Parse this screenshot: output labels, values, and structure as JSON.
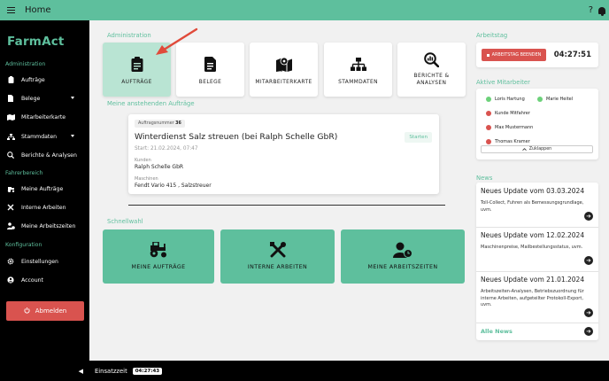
{
  "topbar": {
    "title": "Home",
    "help": "?"
  },
  "sidebar": {
    "brand": "FarmAct",
    "sections": [
      "Administration",
      "Fahrerbereich",
      "Konfiguration"
    ],
    "admin_items": [
      {
        "label": "Aufträge",
        "icon": "clipboard-icon"
      },
      {
        "label": "Belege",
        "icon": "document-icon"
      },
      {
        "label": "Mitarbeiterkarte",
        "icon": "map-icon"
      },
      {
        "label": "Stammdaten",
        "icon": "hierarchy-icon"
      },
      {
        "label": "Berichte & Analysen",
        "icon": "search-chart-icon"
      }
    ],
    "driver_items": [
      {
        "label": "Meine Aufträge",
        "icon": "tractor-icon"
      },
      {
        "label": "Interne Arbeiten",
        "icon": "tools-icon"
      },
      {
        "label": "Meine Arbeitszeiten",
        "icon": "user-clock-icon"
      }
    ],
    "config_items": [
      {
        "label": "Einstellungen",
        "icon": "gear-icon"
      },
      {
        "label": "Account",
        "icon": "account-icon"
      }
    ],
    "logout_label": "Abmelden"
  },
  "main": {
    "admin_heading": "Administration",
    "tiles": [
      "AUFTRÄGE",
      "BELEGE",
      "MITARBEITERKARTE",
      "STAMMDATEN",
      "BERICHTE &",
      "ANALYSEN"
    ],
    "pending_heading": "Meine anstehenden Aufträge",
    "task": {
      "order_label": "Auftragsnummer",
      "order_number": "36",
      "title": "Winterdienst Salz streuen (bei Ralph Schelle GbR)",
      "start_button": "Starten",
      "start": "Start: 21.02.2024, 07:47",
      "customer_label": "Kunden",
      "customer": "Ralph Schelle GbR",
      "machines_label": "Maschinen",
      "machines": "Fendt Vario 415 , Salzstreuer"
    },
    "quick_heading": "Schnellwahl",
    "quick": [
      "MEINE AUFTRÄGE",
      "INTERNE ARBEITEN",
      "MEINE ARBEITSZEITEN"
    ]
  },
  "right": {
    "workday_heading": "Arbeitstag",
    "end_day_label": "ARBEITSTAG BEENDEN",
    "workday_time": "04:27:51",
    "active_heading": "Aktive Mitarbeiter",
    "employees": [
      {
        "name": "Loris Hartung",
        "status": "active"
      },
      {
        "name": "Marie Heitel",
        "status": "active"
      },
      {
        "name": "Kunde Mitfahrer",
        "status": "inactive"
      },
      {
        "name": "Max Mustermann",
        "status": "inactive"
      },
      {
        "name": "Thomas Kramer",
        "status": "inactive"
      }
    ],
    "collapse_label": "Zuklappen",
    "news_heading": "News",
    "news": [
      {
        "title": "Neues Update vom 03.03.2024",
        "text": "Toll-Collect, Fuhren als Bemessungsgrundlage, uvm."
      },
      {
        "title": "Neues Update vom 12.02.2024",
        "text": "Maschinenpreise, Mailbestellungsstatus, uvm."
      },
      {
        "title": "Neues Update vom 21.01.2024",
        "text": "Arbeitszeiten-Analysen, Betriebszuordnung für interne Arbeiten, aufgeteilter Protokoll-Export, uvm."
      }
    ],
    "all_news": "Alle News"
  },
  "bottombar": {
    "label": "Einsatzzeit",
    "timer": "04:27:43"
  },
  "colors": {
    "accent": "#5ebf9d",
    "danger": "#d9534f",
    "active_dot": "#6cd17a",
    "inactive_dot": "#d9534f"
  }
}
